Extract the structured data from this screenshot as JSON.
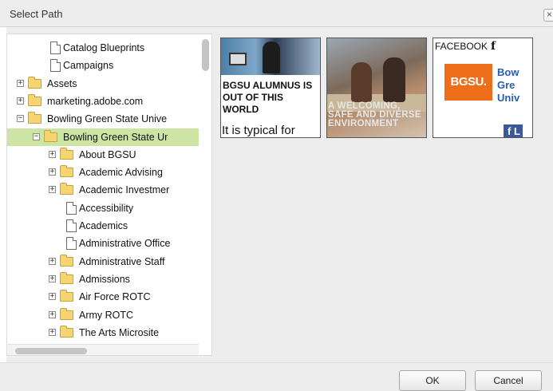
{
  "dialog": {
    "title": "Select Path",
    "close_label": "×"
  },
  "tree": {
    "items": [
      {
        "label": "Catalog Blueprints",
        "type": "page",
        "toggle": ""
      },
      {
        "label": "Campaigns",
        "type": "page",
        "toggle": ""
      },
      {
        "label": "Assets",
        "type": "folder",
        "toggle": "+"
      },
      {
        "label": "marketing.adobe.com",
        "type": "folder",
        "toggle": "+"
      },
      {
        "label": "Bowling Green State Unive",
        "type": "folder",
        "toggle": "−"
      },
      {
        "label": "Bowling Green State Ur",
        "type": "folder",
        "toggle": "−",
        "selected": true
      },
      {
        "label": "About BGSU",
        "type": "folder",
        "toggle": "+"
      },
      {
        "label": "Academic Advising",
        "type": "folder",
        "toggle": "+"
      },
      {
        "label": "Academic Investmer",
        "type": "folder",
        "toggle": "+"
      },
      {
        "label": "Accessibility",
        "type": "page",
        "toggle": ""
      },
      {
        "label": "Academics",
        "type": "page",
        "toggle": ""
      },
      {
        "label": "Administrative Office",
        "type": "page",
        "toggle": ""
      },
      {
        "label": "Administrative Staff",
        "type": "folder",
        "toggle": "+"
      },
      {
        "label": "Admissions",
        "type": "folder",
        "toggle": "+"
      },
      {
        "label": "Air Force ROTC",
        "type": "folder",
        "toggle": "+"
      },
      {
        "label": "Army ROTC",
        "type": "folder",
        "toggle": "+"
      },
      {
        "label": "The Arts Microsite",
        "type": "folder",
        "toggle": "+"
      }
    ]
  },
  "gallery": {
    "card1": {
      "headline": "BGSU ALUMNUS IS OUT OF THIS WORLD",
      "teaser": "It is typical for"
    },
    "card2": {
      "caption": "A WELCOMING, SAFE AND DIVERSE ENVIRONMENT"
    },
    "card3": {
      "label": "FACEBOOK",
      "fb_mark": "f",
      "logo_text": "BGSU.",
      "school_text": "Bow Gre Univ",
      "badge_text": "f L"
    }
  },
  "footer": {
    "ok_label": "OK",
    "cancel_label": "Cancel"
  },
  "colors": {
    "selection": "#cde5a4",
    "folder": "#f6d470",
    "bgsu_orange": "#ee6e1b",
    "facebook_blue": "#3b5998"
  }
}
